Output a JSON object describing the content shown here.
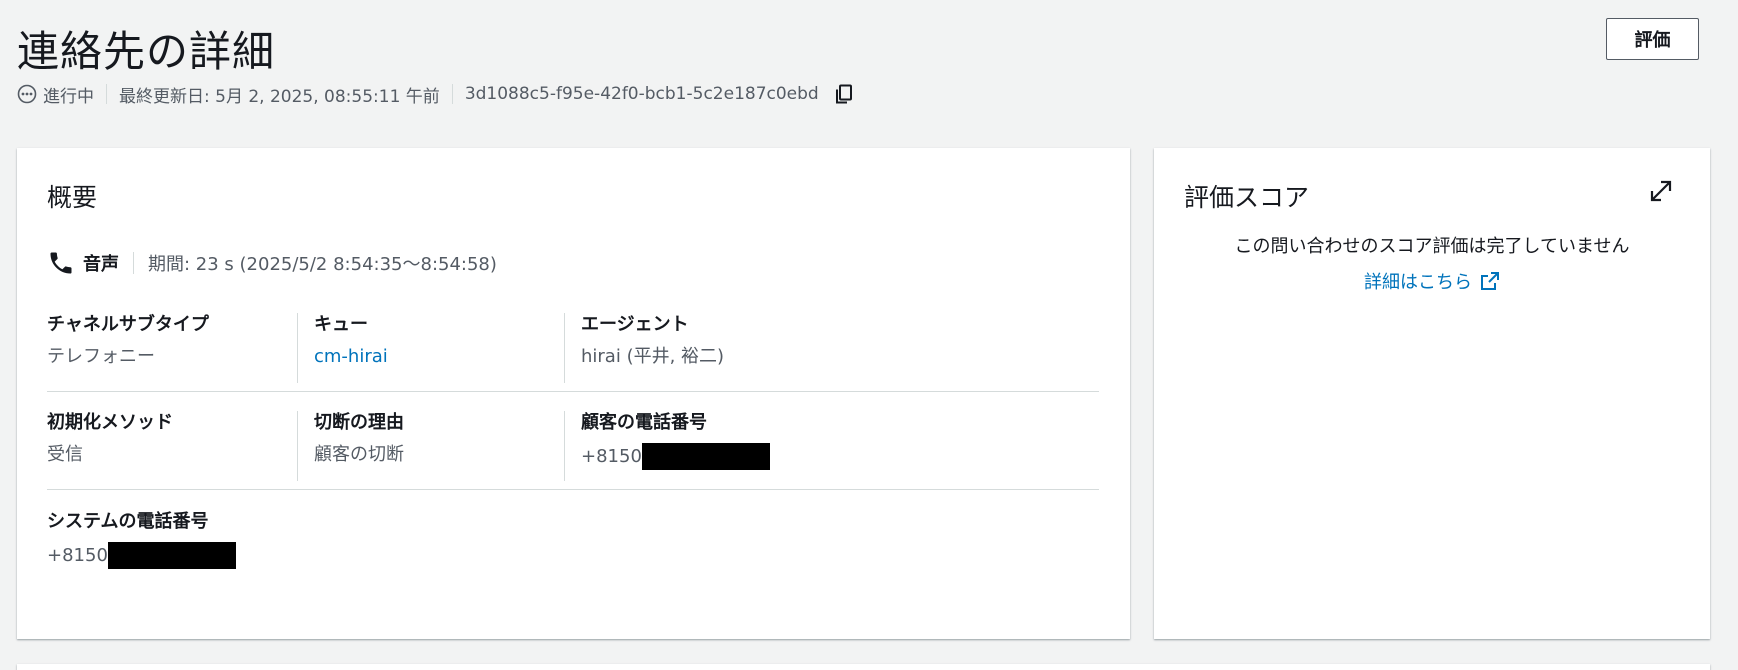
{
  "header": {
    "title": "連絡先の詳細",
    "evaluate_button": "評価",
    "status": "進行中",
    "last_updated": "最終更新日: 5月 2, 2025, 08:55:11 午前",
    "contact_id": "3d1088c5-f95e-42f0-bcb1-5c2e187c0ebd"
  },
  "overview": {
    "title": "概要",
    "channel": "音声",
    "duration": "期間: 23 s (2025/5/2 8:54:35〜8:54:58)",
    "fields": {
      "channel_subtype": {
        "label": "チャネルサブタイプ",
        "value": "テレフォニー"
      },
      "queue": {
        "label": "キュー",
        "value": "cm-hirai"
      },
      "agent": {
        "label": "エージェント",
        "value": "hirai (平井, 裕二)"
      },
      "init_method": {
        "label": "初期化メソッド",
        "value": "受信"
      },
      "disconnect_reason": {
        "label": "切断の理由",
        "value": "顧客の切断"
      },
      "customer_phone": {
        "label": "顧客の電話番号",
        "value": "+8150"
      },
      "system_phone": {
        "label": "システムの電話番号",
        "value": "+8150"
      }
    }
  },
  "score": {
    "title": "評価スコア",
    "message": "この問い合わせのスコア評価は完了していません",
    "link": "詳細はこちら"
  },
  "colors": {
    "link": "#0073bb",
    "text": "#16191f",
    "secondary_text": "#545b64",
    "background": "#f2f3f3"
  },
  "icons": [
    "status-dots-icon",
    "copy-icon",
    "phone-icon",
    "expand-icon",
    "external-link-icon"
  ]
}
